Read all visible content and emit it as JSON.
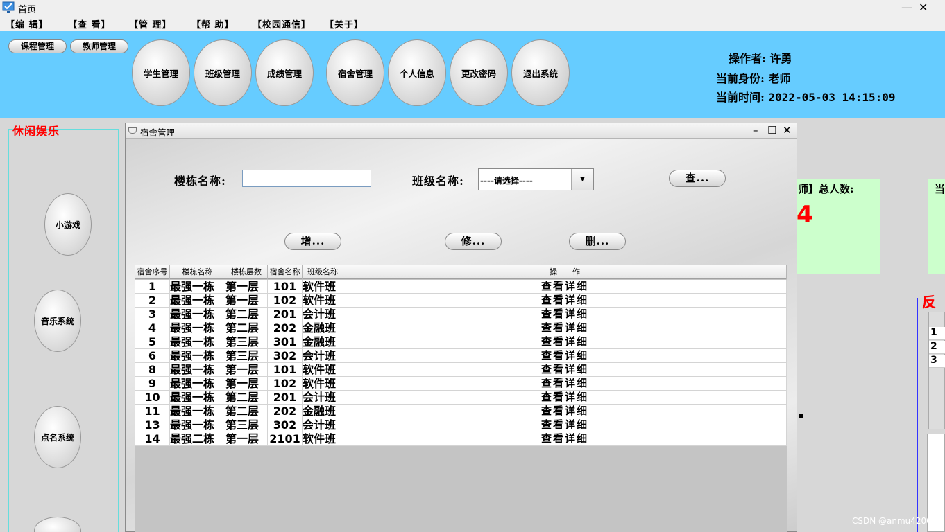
{
  "window": {
    "title": "首页",
    "minimize_icon": "minimize-icon",
    "close_glyph": "✕"
  },
  "menu": [
    "【编 辑】",
    "【查 看】",
    "【管 理】",
    "【帮 助】",
    "【校园通信】",
    "【关于】"
  ],
  "header": {
    "small_buttons": [
      "课程管理",
      "教师管理"
    ],
    "nav_buttons": [
      "学生管理",
      "班级管理",
      "成绩管理",
      "宿舍管理",
      "个人信息",
      "更改密码",
      "退出系统"
    ],
    "operator_label": "操作者:",
    "operator_value": "许勇",
    "role_label": "当前身份:",
    "role_value": "老师",
    "time_label": "当前时间:",
    "time_value": "2022-05-03 14:15:09",
    "background_color": "#66ccff"
  },
  "sidebar": {
    "title": "休闲娱乐",
    "items": [
      "小游戏",
      "音乐系统",
      "点名系统"
    ]
  },
  "background_panels": {
    "stat_label": "师】总人数:",
    "stat_value": "4",
    "stat_label_2": "当",
    "feedback_title": "反",
    "feedback_rows": [
      "1",
      "2",
      "3"
    ]
  },
  "dorm_window": {
    "title": "宿舍管理",
    "building_label": "楼栋名称:",
    "building_value": "",
    "class_label": "班级名称:",
    "class_selected": "----请选择----",
    "search_button": "查...",
    "add_button": "增...",
    "edit_button": "修...",
    "delete_button": "删..."
  },
  "table": {
    "headers": [
      "宿舍序号",
      "楼栋名称",
      "楼栋层数",
      "宿舍名称",
      "班级名称",
      "操　　作"
    ],
    "rows": [
      [
        "1",
        "最强一栋",
        "第一层",
        "101",
        "软件班",
        "查看详细"
      ],
      [
        "2",
        "最强一栋",
        "第一层",
        "102",
        "软件班",
        "查看详细"
      ],
      [
        "3",
        "最强一栋",
        "第二层",
        "201",
        "会计班",
        "查看详细"
      ],
      [
        "4",
        "最强一栋",
        "第二层",
        "202",
        "金融班",
        "查看详细"
      ],
      [
        "5",
        "最强一栋",
        "第三层",
        "301",
        "金融班",
        "查看详细"
      ],
      [
        "6",
        "最强一栋",
        "第三层",
        "302",
        "会计班",
        "查看详细"
      ],
      [
        "8",
        "最强一栋",
        "第一层",
        "101",
        "软件班",
        "查看详细"
      ],
      [
        "9",
        "最强一栋",
        "第一层",
        "102",
        "软件班",
        "查看详细"
      ],
      [
        "10",
        "最强一栋",
        "第二层",
        "201",
        "会计班",
        "查看详细"
      ],
      [
        "11",
        "最强一栋",
        "第二层",
        "202",
        "金融班",
        "查看详细"
      ],
      [
        "13",
        "最强一栋",
        "第三层",
        "302",
        "会计班",
        "查看详细"
      ],
      [
        "14",
        "最强二栋",
        "第一层",
        "2101",
        "软件班",
        "查看详细"
      ]
    ]
  },
  "watermark": "CSDN @anmu4200"
}
